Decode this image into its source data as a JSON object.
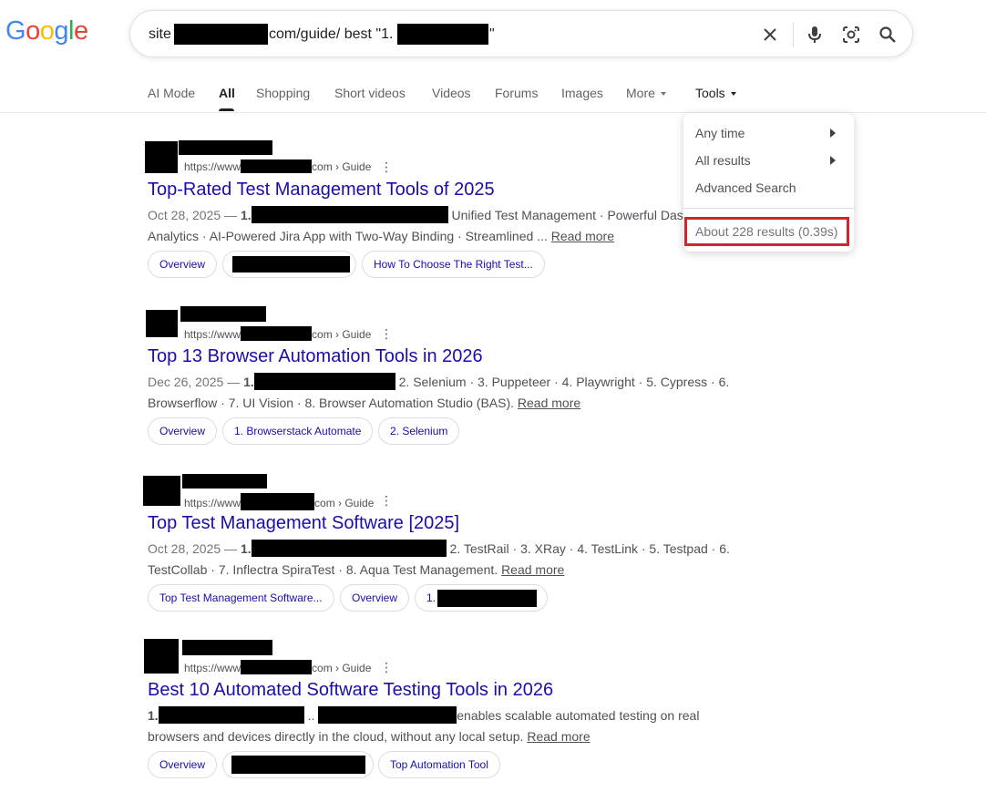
{
  "logo": {
    "text": "Google",
    "letters": [
      "G",
      "o",
      "o",
      "g",
      "l",
      "e"
    ],
    "colors": [
      "#4285f4",
      "#ea4335",
      "#fbbc05",
      "#4285f4",
      "#34a853",
      "#ea4335"
    ]
  },
  "search": {
    "part1": "site",
    "part2": "com/guide/ best \"1.",
    "part3": "\"",
    "clear_icon": "close-icon",
    "voice_icon": "microphone-icon",
    "lens_icon": "camera-lens-icon",
    "search_icon": "search-icon"
  },
  "tabs": [
    {
      "label": "AI Mode"
    },
    {
      "label": "All"
    },
    {
      "label": "Shopping"
    },
    {
      "label": "Short videos"
    },
    {
      "label": "Videos"
    },
    {
      "label": "Forums"
    },
    {
      "label": "Images"
    },
    {
      "label": "More"
    },
    {
      "label": "Tools"
    }
  ],
  "tools_menu": {
    "any_time": "Any time",
    "all_results": "All results",
    "advanced_search": "Advanced Search",
    "results_stats": "About 228 results (0.39s)",
    "highlight_color": "#d6232a"
  },
  "results": [
    {
      "cite_prefix": "https://www",
      "cite_suffix": "com › Guide",
      "title": "Top-Rated Test Management Tools of 2025",
      "date": "Oct 28, 2025 — ",
      "bold": "1.",
      "line1_rest": " Unified Test Management · Powerful Dasl",
      "line2": "Analytics · AI-Powered Jira App with Two-Way Binding · Streamlined ... ",
      "read_more": "Read more",
      "chips": [
        "Overview",
        "",
        "How To Choose The Right Test..."
      ]
    },
    {
      "cite_prefix": "https://www",
      "cite_suffix": "com › Guide",
      "title": "Top 13 Browser Automation Tools in 2026",
      "date": "Dec 26, 2025 — ",
      "bold": "1.",
      "line1_rest": " 2. Selenium · 3. Puppeteer · 4. Playwright · 5. Cypress · 6.",
      "line2": "Browserflow · 7. UI Vision · 8. Browser Automation Studio (BAS). ",
      "read_more": "Read more",
      "chips": [
        "Overview",
        "1. Browserstack Automate",
        "2. Selenium"
      ]
    },
    {
      "cite_prefix": "https://www",
      "cite_suffix": "com › Guide",
      "title": "Top Test Management Software [2025]",
      "date": "Oct 28, 2025 — ",
      "bold": "1.",
      "line1_rest": " 2. TestRail · 3. XRay · 4. TestLink · 5. Testpad · 6.",
      "line2": "TestCollab · 7. Inflectra SpiraTest · 8. Aqua Test Management. ",
      "read_more": "Read more",
      "chips": [
        "Top Test Management Software...",
        "Overview",
        "1."
      ]
    },
    {
      "cite_prefix": "https://www",
      "cite_suffix": "com › Guide",
      "title": "Best 10 Automated Software Testing Tools in 2026",
      "date": "",
      "bold": "1.",
      "line1_mid": " .. ",
      "line1_rest": "enables scalable automated testing on real",
      "line2": "browsers and devices directly in the cloud, without any local setup. ",
      "read_more": "Read more",
      "chips": [
        "Overview",
        "",
        "Top Automation Tool"
      ]
    }
  ]
}
